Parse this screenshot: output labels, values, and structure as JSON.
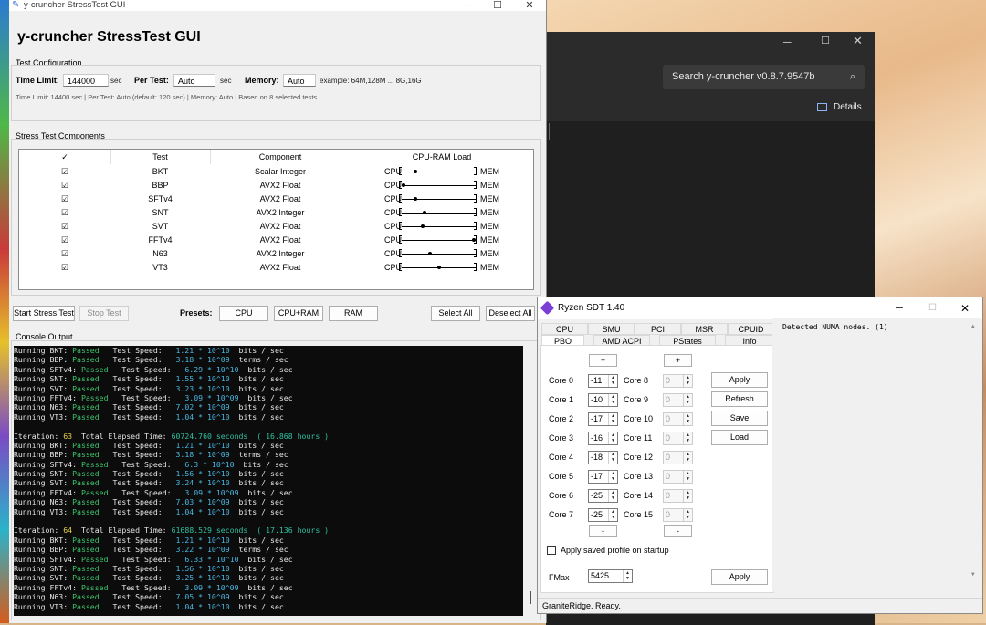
{
  "ycruncher": {
    "window_title": "y-cruncher StressTest GUI",
    "heading": "y-cruncher StressTest GUI",
    "config": {
      "group_label": "Test Configuration",
      "time_limit_label": "Time Limit:",
      "time_limit_value": "144000",
      "time_unit": "sec",
      "per_test_label": "Per Test:",
      "per_test_value": "Auto",
      "per_test_unit": "sec",
      "memory_label": "Memory:",
      "memory_value": "Auto",
      "memory_example": "example: 64M,128M ... 8G,16G",
      "summary": "Time Limit: 14400 sec | Per Test: Auto (default: 120 sec) | Memory: Auto | Based on 8 selected tests"
    },
    "components": {
      "group_label": "Stress Test Components",
      "headers": [
        "✓",
        "Test",
        "Component",
        "CPU-RAM Load"
      ],
      "rows": [
        {
          "check": "☑",
          "test": "BKT",
          "component": "Scalar Integer",
          "load": 0.18
        },
        {
          "check": "☑",
          "test": "BBP",
          "component": "AVX2 Float",
          "load": 0.02
        },
        {
          "check": "☑",
          "test": "SFTv4",
          "component": "AVX2 Float",
          "load": 0.18
        },
        {
          "check": "☑",
          "test": "SNT",
          "component": "AVX2 Integer",
          "load": 0.3
        },
        {
          "check": "☑",
          "test": "SVT",
          "component": "AVX2 Float",
          "load": 0.28
        },
        {
          "check": "☑",
          "test": "FFTv4",
          "component": "AVX2 Float",
          "load": 0.96
        },
        {
          "check": "☑",
          "test": "N63",
          "component": "AVX2 Integer",
          "load": 0.38
        },
        {
          "check": "☑",
          "test": "VT3",
          "component": "AVX2 Float",
          "load": 0.5
        }
      ],
      "cpu_label": "CPU",
      "mem_label": "MEM"
    },
    "buttons": {
      "start": "Start Stress Test",
      "stop": "Stop Test",
      "presets_label": "Presets:",
      "preset_cpu": "CPU",
      "preset_cpuram": "CPU+RAM",
      "preset_ram": "RAM",
      "select_all": "Select All",
      "deselect_all": "Deselect All"
    },
    "console": {
      "label": "Console Output",
      "lines": [
        {
          "type": "test",
          "name": "BKT:",
          "status": "Passed",
          "pad": "   ",
          "speed": "1.21 * 10^10",
          "unit": "  bits / sec"
        },
        {
          "type": "test",
          "name": "BBP:",
          "status": "Passed",
          "pad": "   ",
          "speed": "3.18 * 10^09",
          "unit": "  terms / sec"
        },
        {
          "type": "test",
          "name": "SFTv4:",
          "status": "Passed",
          "pad": "   ",
          "speed": "6.29 * 10^10",
          "unit": "  bits / sec"
        },
        {
          "type": "test",
          "name": "SNT:",
          "status": "Passed",
          "pad": "   ",
          "speed": "1.55 * 10^10",
          "unit": "  bits / sec"
        },
        {
          "type": "test",
          "name": "SVT:",
          "status": "Passed",
          "pad": "   ",
          "speed": "3.23 * 10^10",
          "unit": "  bits / sec"
        },
        {
          "type": "test",
          "name": "FFTv4:",
          "status": "Passed",
          "pad": "   ",
          "speed": "3.09 * 10^09",
          "unit": "  bits / sec"
        },
        {
          "type": "test",
          "name": "N63:",
          "status": "Passed",
          "pad": "   ",
          "speed": "7.02 * 10^09",
          "unit": "  bits / sec"
        },
        {
          "type": "test",
          "name": "VT3:",
          "status": "Passed",
          "pad": "   ",
          "speed": "1.04 * 10^10",
          "unit": "  bits / sec"
        },
        {
          "type": "blank"
        },
        {
          "type": "iter",
          "n": "63",
          "elapsed": "60724.760 seconds",
          "hours": "( 16.868 hours )"
        },
        {
          "type": "test",
          "name": "BKT:",
          "status": "Passed",
          "pad": "   ",
          "speed": "1.21 * 10^10",
          "unit": "  bits / sec"
        },
        {
          "type": "test",
          "name": "BBP:",
          "status": "Passed",
          "pad": "   ",
          "speed": "3.18 * 10^09",
          "unit": "  terms / sec"
        },
        {
          "type": "test",
          "name": "SFTv4:",
          "status": "Passed",
          "pad": "   ",
          "speed": "6.3 * 10^10",
          "unit": "  bits / sec"
        },
        {
          "type": "test",
          "name": "SNT:",
          "status": "Passed",
          "pad": "   ",
          "speed": "1.56 * 10^10",
          "unit": "  bits / sec"
        },
        {
          "type": "test",
          "name": "SVT:",
          "status": "Passed",
          "pad": "   ",
          "speed": "3.24 * 10^10",
          "unit": "  bits / sec"
        },
        {
          "type": "test",
          "name": "FFTv4:",
          "status": "Passed",
          "pad": "   ",
          "speed": "3.09 * 10^09",
          "unit": "  bits / sec"
        },
        {
          "type": "test",
          "name": "N63:",
          "status": "Passed",
          "pad": "   ",
          "speed": "7.03 * 10^09",
          "unit": "  bits / sec"
        },
        {
          "type": "test",
          "name": "VT3:",
          "status": "Passed",
          "pad": "   ",
          "speed": "1.04 * 10^10",
          "unit": "  bits / sec"
        },
        {
          "type": "blank"
        },
        {
          "type": "iter",
          "n": "64",
          "elapsed": "61688.529 seconds",
          "hours": "( 17.136 hours )"
        },
        {
          "type": "test",
          "name": "BKT:",
          "status": "Passed",
          "pad": "   ",
          "speed": "1.21 * 10^10",
          "unit": "  bits / sec"
        },
        {
          "type": "test",
          "name": "BBP:",
          "status": "Passed",
          "pad": "   ",
          "speed": "3.22 * 10^09",
          "unit": "  terms / sec"
        },
        {
          "type": "test",
          "name": "SFTv4:",
          "status": "Passed",
          "pad": "   ",
          "speed": "6.33 * 10^10",
          "unit": "  bits / sec"
        },
        {
          "type": "test",
          "name": "SNT:",
          "status": "Passed",
          "pad": "   ",
          "speed": "1.56 * 10^10",
          "unit": "  bits / sec"
        },
        {
          "type": "test",
          "name": "SVT:",
          "status": "Passed",
          "pad": "   ",
          "speed": "3.25 * 10^10",
          "unit": "  bits / sec"
        },
        {
          "type": "test",
          "name": "FFTv4:",
          "status": "Passed",
          "pad": "   ",
          "speed": "3.09 * 10^09",
          "unit": "  bits / sec"
        },
        {
          "type": "test",
          "name": "N63:",
          "status": "Passed",
          "pad": "   ",
          "speed": "7.05 * 10^09",
          "unit": "  bits / sec"
        },
        {
          "type": "test",
          "name": "VT3:",
          "status": "Passed",
          "pad": "   ",
          "speed": "1.04 * 10^10",
          "unit": "  bits / sec"
        }
      ],
      "running_prefix": "Running ",
      "speed_label": "Test Speed:",
      "iteration_label": "Iteration:",
      "elapsed_label": "Total Elapsed Time:"
    }
  },
  "search_window": {
    "search_text": "Search y-cruncher v0.8.7.9547b",
    "details_label": "Details"
  },
  "ryzen": {
    "window_title": "Ryzen SDT 1.40",
    "tabs_row1": [
      "CPU",
      "SMU",
      "PCI",
      "MSR",
      "CPUID"
    ],
    "tabs_row2": [
      "PBO",
      "AMD ACPI",
      "PStates",
      "Info"
    ],
    "plus": "+",
    "minus": "-",
    "cores_left": [
      {
        "label": "Core 0",
        "value": "-11"
      },
      {
        "label": "Core 1",
        "value": "-10"
      },
      {
        "label": "Core 2",
        "value": "-17"
      },
      {
        "label": "Core 3",
        "value": "-16"
      },
      {
        "label": "Core 4",
        "value": "-18"
      },
      {
        "label": "Core 5",
        "value": "-17"
      },
      {
        "label": "Core 6",
        "value": "-25"
      },
      {
        "label": "Core 7",
        "value": "-25"
      }
    ],
    "cores_right": [
      {
        "label": "Core 8",
        "value": "0"
      },
      {
        "label": "Core 9",
        "value": "0"
      },
      {
        "label": "Core 10",
        "value": "0"
      },
      {
        "label": "Core 11",
        "value": "0"
      },
      {
        "label": "Core 12",
        "value": "0"
      },
      {
        "label": "Core 13",
        "value": "0"
      },
      {
        "label": "Core 14",
        "value": "0"
      },
      {
        "label": "Core 15",
        "value": "0"
      }
    ],
    "actions": [
      "Apply",
      "Refresh",
      "Save",
      "Load"
    ],
    "apply_on_startup": "Apply saved profile on startup",
    "fmax_label": "FMax",
    "fmax_value": "5425",
    "fmax_apply": "Apply",
    "log_text": "Detected NUMA nodes. (1)",
    "status": "GraniteRidge. Ready."
  }
}
